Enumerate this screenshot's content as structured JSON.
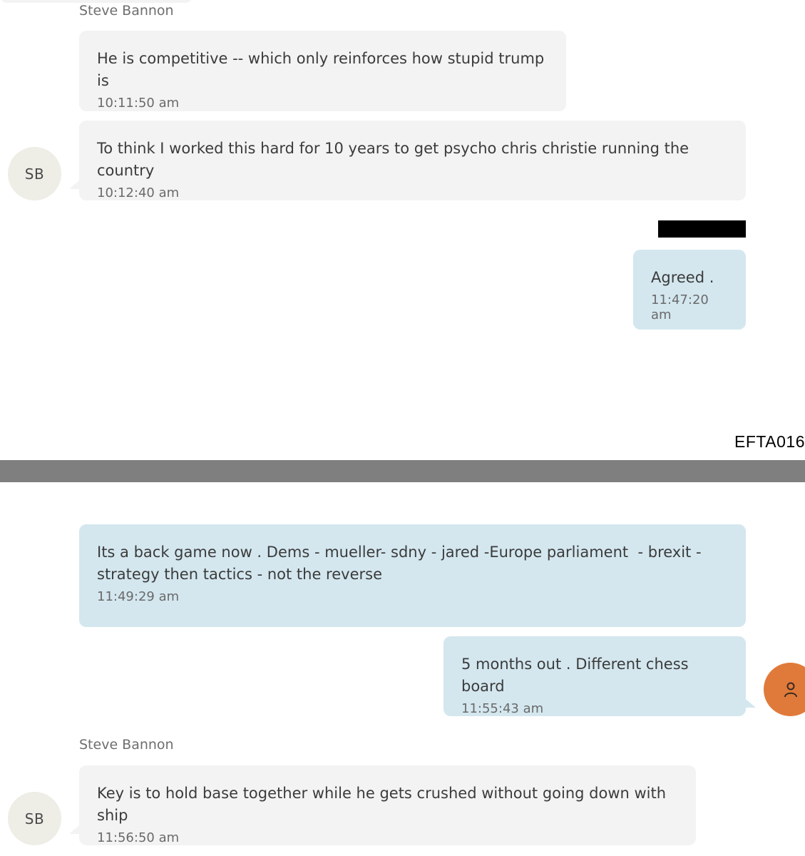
{
  "colors": {
    "incoming_bubble": "#f3f3f3",
    "outgoing_bubble": "#d4e7ef",
    "avatar_sb": "#eeede6",
    "avatar_me": "#e07a3a",
    "divider": "#7f7f7f"
  },
  "document": {
    "bates_number": "EFTA016"
  },
  "page_top": {
    "sender_label": "Steve Bannon",
    "messages": [
      {
        "text": "He is competitive -- which only reinforces how stupid trump is",
        "time": "10:11:50 am",
        "direction": "incoming"
      },
      {
        "text": "To think I worked this hard for 10 years to get psycho chris christie running the country",
        "time": "10:12:40 am",
        "direction": "incoming"
      },
      {
        "text": "Agreed .",
        "time": "11:47:20 am",
        "direction": "outgoing"
      }
    ],
    "avatar_initials": "SB"
  },
  "page_bottom": {
    "messages": [
      {
        "text": "Its a back game now . Dems - mueller- sdny - jared -Europe parliament  - brexit -\nstrategy then tactics - not the reverse",
        "time": "11:49:29 am",
        "direction": "outgoing"
      },
      {
        "text": "5 months out . Different chess board",
        "time": "11:55:43 am",
        "direction": "outgoing"
      },
      {
        "text": "Key is to hold base together while he gets crushed without going down with ship",
        "time": "11:56:50 am",
        "direction": "incoming"
      }
    ],
    "sender_label": "Steve Bannon",
    "avatar_initials": "SB",
    "me_avatar_icon": "person-icon"
  }
}
